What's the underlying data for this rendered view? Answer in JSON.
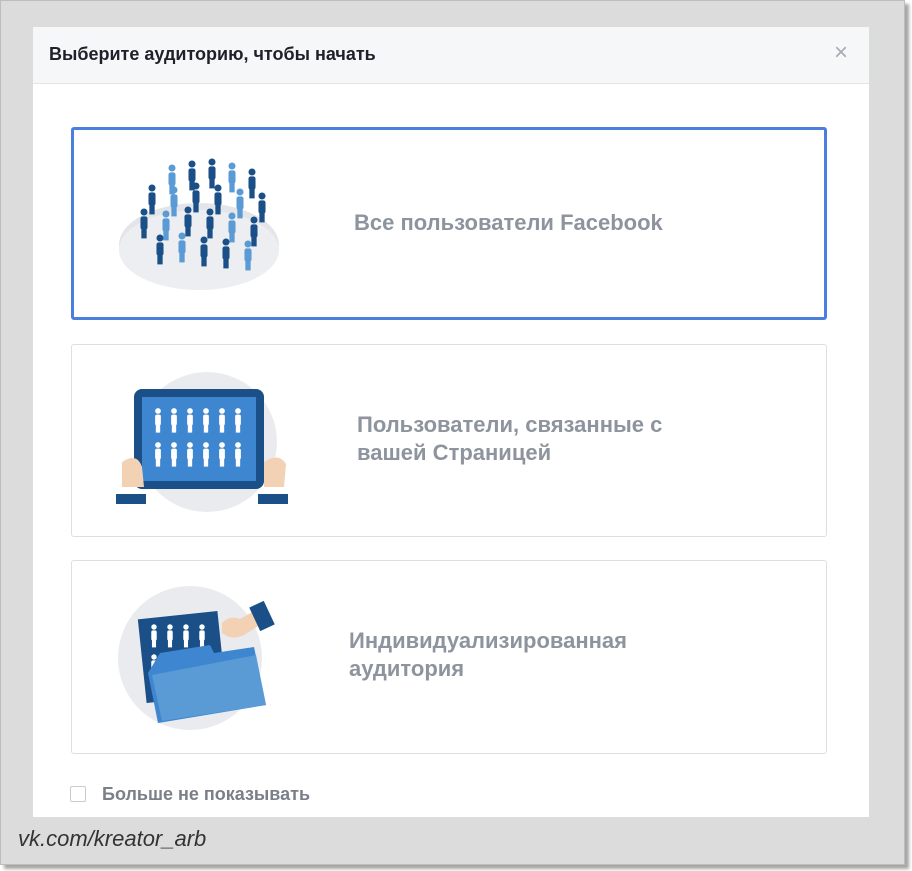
{
  "dialog": {
    "title": "Выберите аудиторию, чтобы начать",
    "close_symbol": "×"
  },
  "options": [
    {
      "label": "Все пользователи Facebook",
      "icon": "crowd-icon",
      "selected": true
    },
    {
      "label": "Пользователи, связанные с вашей Страницей",
      "icon": "tablet-audience-icon",
      "selected": false
    },
    {
      "label": "Индивидуализированная аудитория",
      "icon": "folder-audience-icon",
      "selected": false
    }
  ],
  "checkbox": {
    "label": "Больше не показывать",
    "checked": false
  },
  "watermark": "vk.com/kreator_arb",
  "colors": {
    "accent": "#4a7fe0",
    "header_bg": "#f6f7f9",
    "label_gray": "#8d949e",
    "person_dark": "#1a4f87",
    "person_light": "#5b9bd5"
  }
}
